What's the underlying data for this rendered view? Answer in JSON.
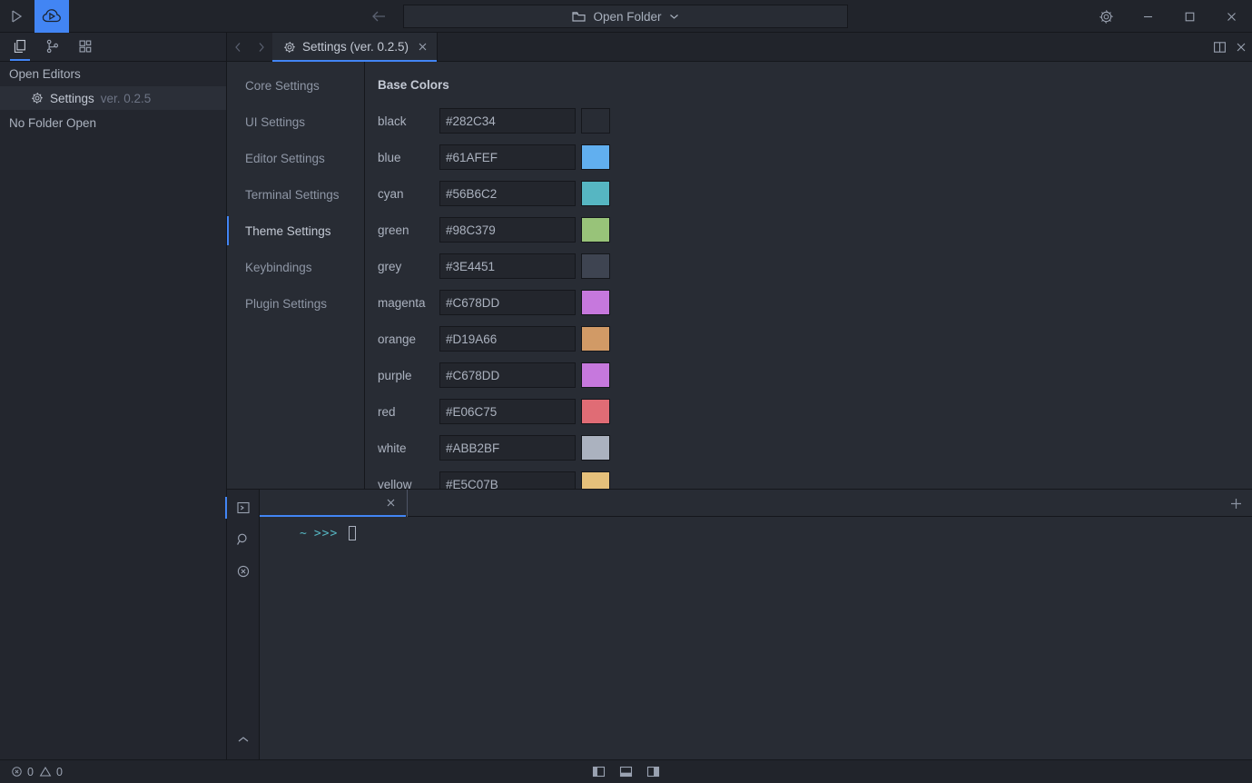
{
  "titlebar": {
    "logo_icon": "play-outline-icon",
    "app_logo_icon": "cloud-play-icon",
    "back_icon": "arrow-left-icon",
    "forward_icon": "arrow-right-icon",
    "open_folder_label": "Open Folder",
    "open_folder_icon": "folder-icon",
    "open_folder_chevron": "chevron-down-icon",
    "settings_icon": "gear-icon",
    "minimize_icon": "minimize-icon",
    "maximize_icon": "maximize-icon",
    "close_icon": "close-icon"
  },
  "sidebar": {
    "icons": [
      {
        "name": "explorer-icon"
      },
      {
        "name": "source-control-icon"
      },
      {
        "name": "extensions-icon"
      }
    ],
    "open_editors_label": "Open Editors",
    "open_editor": {
      "icon": "gear-icon",
      "name": "Settings",
      "version": "ver. 0.2.5"
    },
    "no_folder_label": "No Folder Open"
  },
  "tabbar": {
    "prev_icon": "chevron-left-icon",
    "next_icon": "chevron-right-icon",
    "tabs": [
      {
        "icon": "gear-icon",
        "label": "Settings (ver. 0.2.5)",
        "close_icon": "close-icon",
        "active": true
      }
    ],
    "split_editor_icon": "split-editor-icon",
    "close_editor_icon": "close-icon"
  },
  "settings": {
    "nav_items": [
      {
        "label": "Core Settings",
        "active": false
      },
      {
        "label": "UI Settings",
        "active": false
      },
      {
        "label": "Editor Settings",
        "active": false
      },
      {
        "label": "Terminal Settings",
        "active": false
      },
      {
        "label": "Theme Settings",
        "active": true
      },
      {
        "label": "Keybindings",
        "active": false
      },
      {
        "label": "Plugin Settings",
        "active": false
      }
    ],
    "section_title": "Base Colors",
    "colors": [
      {
        "label": "black",
        "value": "#282C34",
        "swatch": "#282C34"
      },
      {
        "label": "blue",
        "value": "#61AFEF",
        "swatch": "#61AFEF"
      },
      {
        "label": "cyan",
        "value": "#56B6C2",
        "swatch": "#56B6C2"
      },
      {
        "label": "green",
        "value": "#98C379",
        "swatch": "#98C379"
      },
      {
        "label": "grey",
        "value": "#3E4451",
        "swatch": "#3E4451"
      },
      {
        "label": "magenta",
        "value": "#C678DD",
        "swatch": "#C678DD"
      },
      {
        "label": "orange",
        "value": "#D19A66",
        "swatch": "#D19A66"
      },
      {
        "label": "purple",
        "value": "#C678DD",
        "swatch": "#C678DD"
      },
      {
        "label": "red",
        "value": "#E06C75",
        "swatch": "#E06C75"
      },
      {
        "label": "white",
        "value": "#ABB2BF",
        "swatch": "#ABB2BF"
      },
      {
        "label": "yellow",
        "value": "#E5C07B",
        "swatch": "#E5C07B"
      }
    ]
  },
  "panel": {
    "rail": [
      {
        "name": "terminal-icon",
        "active": true
      },
      {
        "name": "search-icon",
        "active": false
      },
      {
        "name": "clear-icon",
        "active": false
      }
    ],
    "collapse_icon": "chevron-up-icon",
    "tab_label": "",
    "tab_close_icon": "close-icon",
    "add_icon": "plus-icon",
    "terminal": {
      "tilde": "~",
      "prompt": ">>>",
      "command": ""
    }
  },
  "statusbar": {
    "error_icon": "error-circle-icon",
    "error_count": "0",
    "warning_icon": "warning-triangle-icon",
    "warning_count": "0",
    "layout_icons": [
      {
        "name": "toggle-sidebar-icon"
      },
      {
        "name": "toggle-panel-icon"
      },
      {
        "name": "toggle-split-icon"
      }
    ]
  }
}
